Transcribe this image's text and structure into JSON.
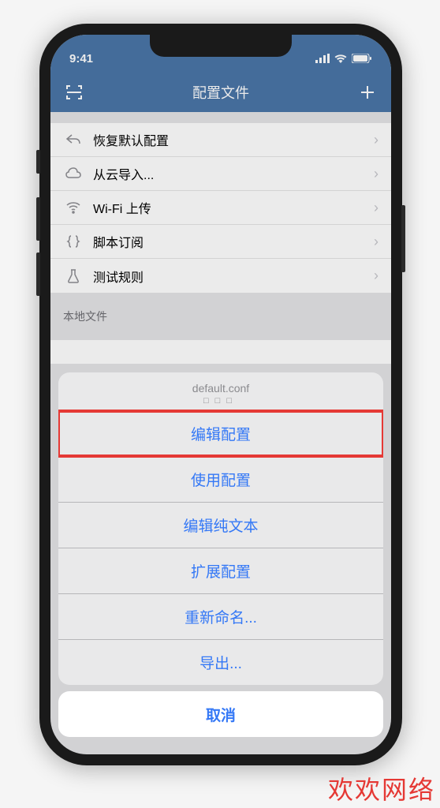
{
  "status": {
    "time": "9:41"
  },
  "nav": {
    "title": "配置文件"
  },
  "list1": {
    "items": [
      {
        "label": "恢复默认配置",
        "icon": "reply"
      },
      {
        "label": "从云导入...",
        "icon": "cloud"
      },
      {
        "label": "Wi-Fi 上传",
        "icon": "wifi"
      },
      {
        "label": "脚本订阅",
        "icon": "braces"
      },
      {
        "label": "测试规则",
        "icon": "flask"
      }
    ]
  },
  "section_local": "本地文件",
  "sheet": {
    "title": "default.conf",
    "sub": "□□□",
    "items": [
      "编辑配置",
      "使用配置",
      "编辑纯文本",
      "扩展配置",
      "重新命名...",
      "导出..."
    ],
    "cancel": "取消"
  },
  "watermark": "欢欢网络"
}
